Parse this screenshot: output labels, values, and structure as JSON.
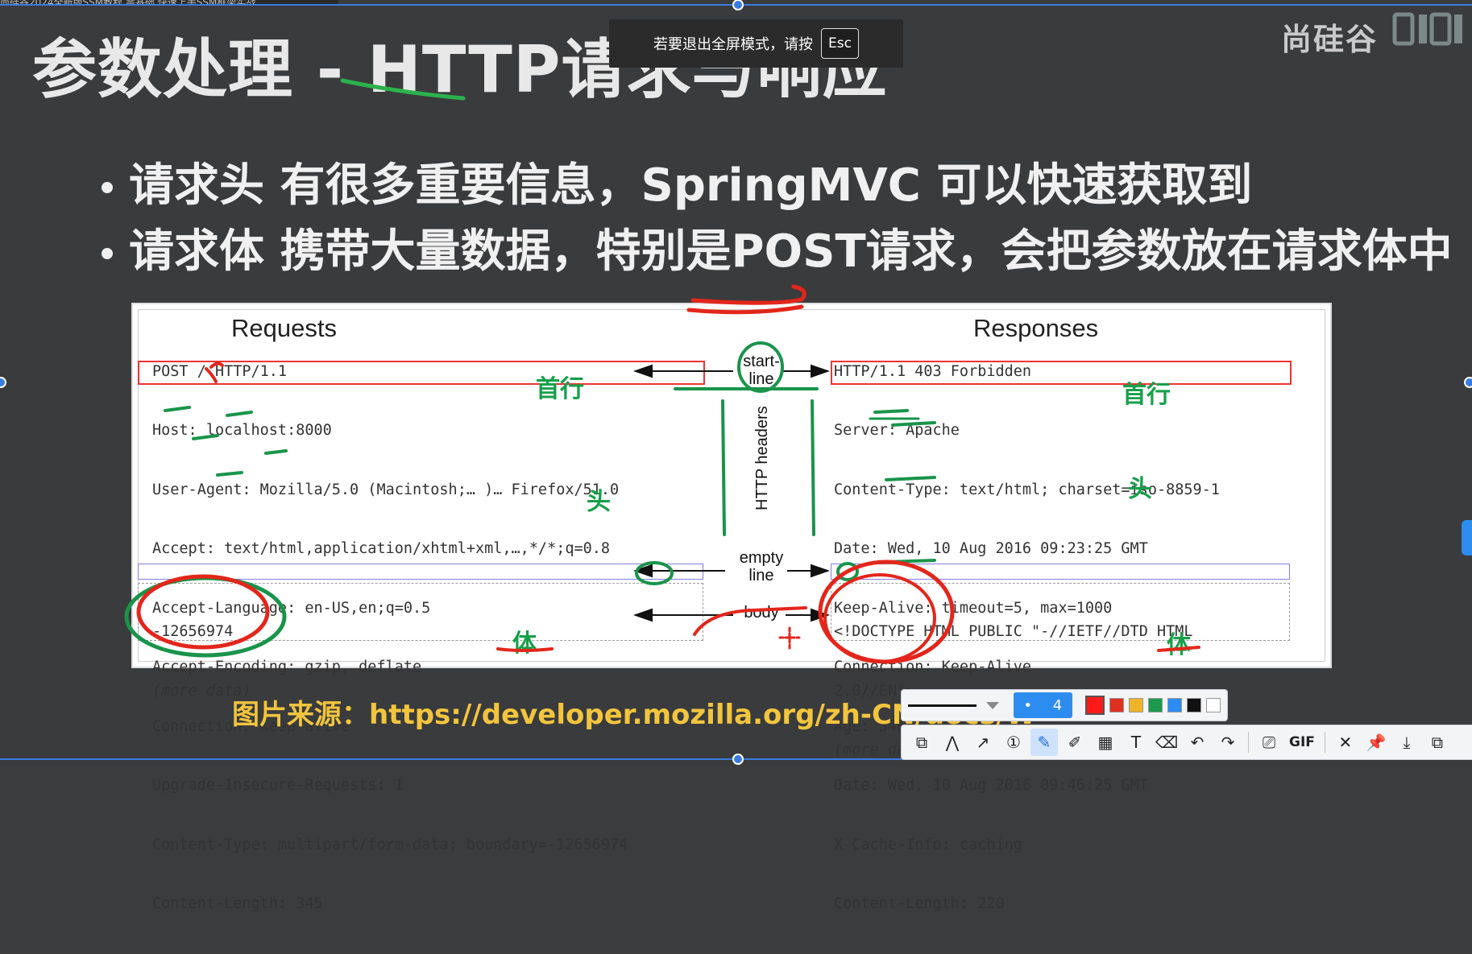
{
  "slide": {
    "title": "参数处理 - HTTP请求与响应",
    "brand": "尚硅谷",
    "top_strip_text": "尚硅谷2024全新版SSM教程,零基础,快速上手SSM框架实战",
    "bullets": [
      "请求头 有很多重要信息，SpringMVC 可以快速获取到",
      "请求体 携带大量数据，特别是POST请求，会把参数放在请求体中"
    ],
    "source": "图片来源：https://developer.mozilla.org/zh-CN/docs/W"
  },
  "fullscreen_notice": {
    "text": "若要退出全屏模式，请按",
    "key": "Esc"
  },
  "figure": {
    "requests_title": "Requests",
    "responses_title": "Responses",
    "request_start_line": "POST / HTTP/1.1",
    "request_headers": [
      "Host: localhost:8000",
      "User-Agent: Mozilla/5.0 (Macintosh;… )… Firefox/51.0",
      "Accept: text/html,application/xhtml+xml,…,*/*;q=0.8",
      "Accept-Language: en-US,en;q=0.5",
      "Accept-Encoding: gzip, deflate",
      "Connection: keep-alive",
      "Upgrade-Insecure-Requests: 1",
      "Content-Type: multipart/form-data; boundary=-12656974",
      "Content-Length: 345"
    ],
    "request_body": [
      "-12656974",
      "(more data)"
    ],
    "response_start_line": "HTTP/1.1 403 Forbidden",
    "response_headers": [
      "Server: Apache",
      "Content-Type: text/html; charset=iso-8859-1",
      "Date: Wed, 10 Aug 2016 09:23:25 GMT",
      "Keep-Alive: timeout=5, max=1000",
      "Connection: Keep-Alive",
      "Age: 3464",
      "Date: Wed, 10 Aug 2016 09:46:25 GMT",
      "X-Cache-Info: caching",
      "Content-Length: 220"
    ],
    "response_body": [
      "<!DOCTYPE HTML PUBLIC \"-//IETF//DTD HTML",
      "2.0//EN\">",
      "(more data)"
    ],
    "mid_labels": {
      "start_line": [
        "start-",
        "line"
      ],
      "http_headers": "HTTP headers",
      "empty_line": [
        "empty",
        "line"
      ],
      "body": "body"
    },
    "annotations": {
      "first_line_left": "首行",
      "first_line_right": "首行",
      "head_left": "头",
      "head_right": "头",
      "body_left": "体",
      "body_right": "体"
    }
  },
  "draw_toolbar": {
    "size_value": "4",
    "colors": [
      "#ff1a1a",
      "#e03020",
      "#f0b429",
      "#1a9a4a",
      "#2d8cf0",
      "#111111",
      "#ffffff"
    ],
    "selected_color": "#ff1a1a"
  },
  "tools_toolbar": {
    "tools": [
      {
        "name": "shape-icon",
        "glyph": "⧉"
      },
      {
        "name": "polyline-icon",
        "glyph": "⋀"
      },
      {
        "name": "arrow-icon",
        "glyph": "↗"
      },
      {
        "name": "number-icon",
        "glyph": "①"
      },
      {
        "name": "pen-icon",
        "glyph": "✎"
      },
      {
        "name": "marker-icon",
        "glyph": "✐"
      },
      {
        "name": "mosaic-icon",
        "glyph": "▦"
      },
      {
        "name": "text-icon",
        "glyph": "T"
      },
      {
        "name": "eraser-icon",
        "glyph": "⌫"
      },
      {
        "name": "undo-icon",
        "glyph": "↶"
      },
      {
        "name": "redo-icon",
        "glyph": "↷"
      }
    ],
    "gif_label": "GIF",
    "actions": [
      {
        "name": "close-icon",
        "glyph": "✕"
      },
      {
        "name": "pin-icon",
        "glyph": "📌"
      },
      {
        "name": "download-icon",
        "glyph": "⤓"
      },
      {
        "name": "copy-icon",
        "glyph": "⧉"
      }
    ]
  }
}
